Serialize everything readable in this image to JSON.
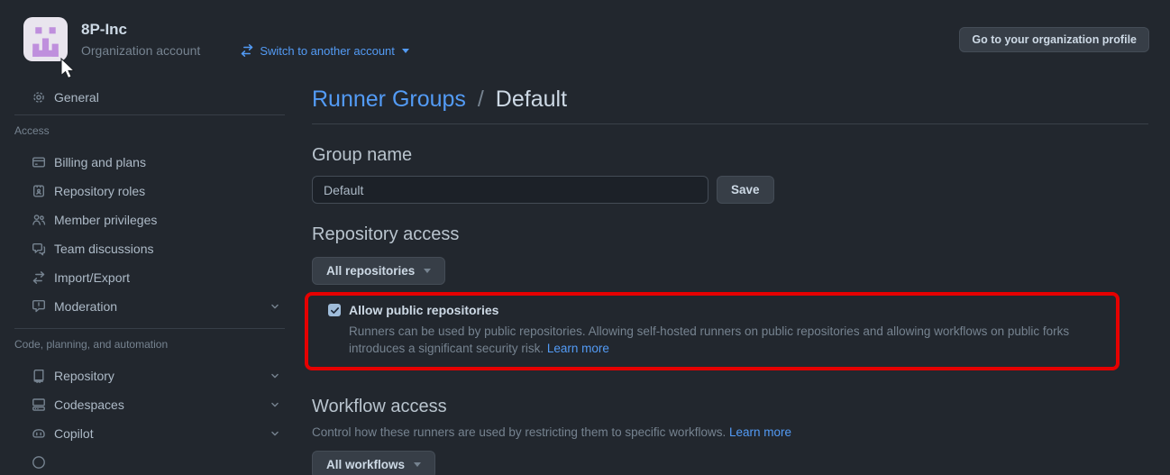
{
  "colors": {
    "accent_blue": "#539bf5",
    "highlight_red": "#e60000",
    "avatar_purple": "#bf8fdd"
  },
  "header": {
    "org_name": "8P-Inc",
    "account_type": "Organization account",
    "switch_account_label": "Switch to another account",
    "profile_button_label": "Go to your organization profile"
  },
  "sidebar": {
    "sections": [
      {
        "label": "",
        "items": [
          {
            "label": "General",
            "icon": "gear-icon"
          }
        ]
      },
      {
        "label": "Access",
        "items": [
          {
            "label": "Billing and plans",
            "icon": "credit-card-icon"
          },
          {
            "label": "Repository roles",
            "icon": "id-badge-icon"
          },
          {
            "label": "Member privileges",
            "icon": "people-icon"
          },
          {
            "label": "Team discussions",
            "icon": "comment-discussion-icon"
          },
          {
            "label": "Import/Export",
            "icon": "arrow-switch-icon"
          },
          {
            "label": "Moderation",
            "icon": "report-icon",
            "expandable": true
          }
        ]
      },
      {
        "label": "Code, planning, and automation",
        "items": [
          {
            "label": "Repository",
            "icon": "repo-icon",
            "expandable": true
          },
          {
            "label": "Codespaces",
            "icon": "codespaces-icon",
            "expandable": true
          },
          {
            "label": "Copilot",
            "icon": "copilot-icon",
            "expandable": true
          }
        ]
      }
    ]
  },
  "main": {
    "breadcrumb": {
      "parent": "Runner Groups",
      "separator": "/",
      "current": "Default"
    },
    "group_name": {
      "heading": "Group name",
      "input_value": "Default",
      "save_label": "Save"
    },
    "repository_access": {
      "heading": "Repository access",
      "dropdown_label": "All repositories",
      "allow_public": {
        "checked": true,
        "label": "Allow public repositories",
        "description": "Runners can be used by public repositories. Allowing self-hosted runners on public repositories and allowing workflows on public forks introduces a significant security risk.",
        "learn_more_label": "Learn more"
      }
    },
    "workflow_access": {
      "heading": "Workflow access",
      "description": "Control how these runners are used by restricting them to specific workflows.",
      "learn_more_label": "Learn more",
      "dropdown_label": "All workflows"
    }
  }
}
